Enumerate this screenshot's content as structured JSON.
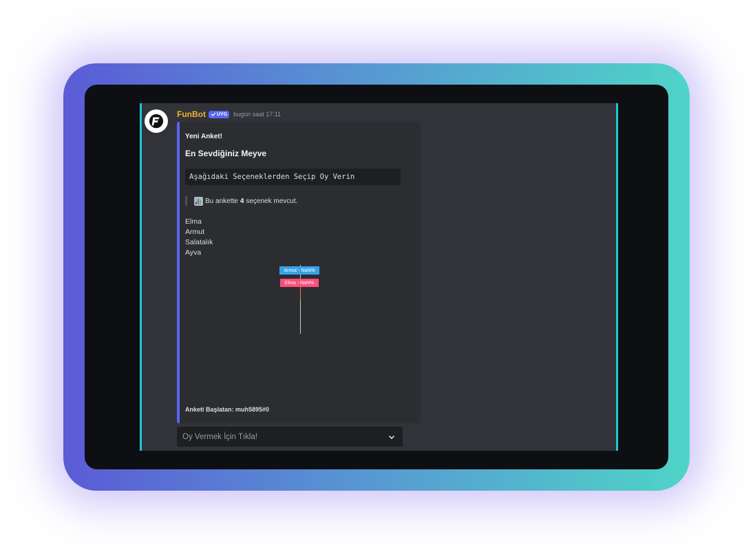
{
  "message": {
    "username": "FunBot",
    "badge": "UYG",
    "timestamp": "bugün saat 17:11"
  },
  "embed": {
    "author": "Yeni Anket!",
    "title": "En Sevdiğiniz Meyve",
    "code": "Aşağıdaki Seçeneklerden Seçip Oy Verin",
    "quote_prefix": "Bu ankette",
    "quote_count": "4",
    "quote_suffix": "seçenek mevcut.",
    "options": [
      "Elma",
      "Armut",
      "Salatalık",
      "Ayva"
    ],
    "chart_labels": {
      "armut": "Armut - NaN%",
      "elma": "Elma - NaN%"
    },
    "footer": "Anketi Başlatan: muh5895#0",
    "colors": {
      "accent": "#5865f2",
      "armut": "#36a2eb",
      "elma": "#ff4f7b"
    }
  },
  "select": {
    "placeholder": "Oy Vermek İçin Tıkla!",
    "icon": "chevron-down-icon"
  }
}
